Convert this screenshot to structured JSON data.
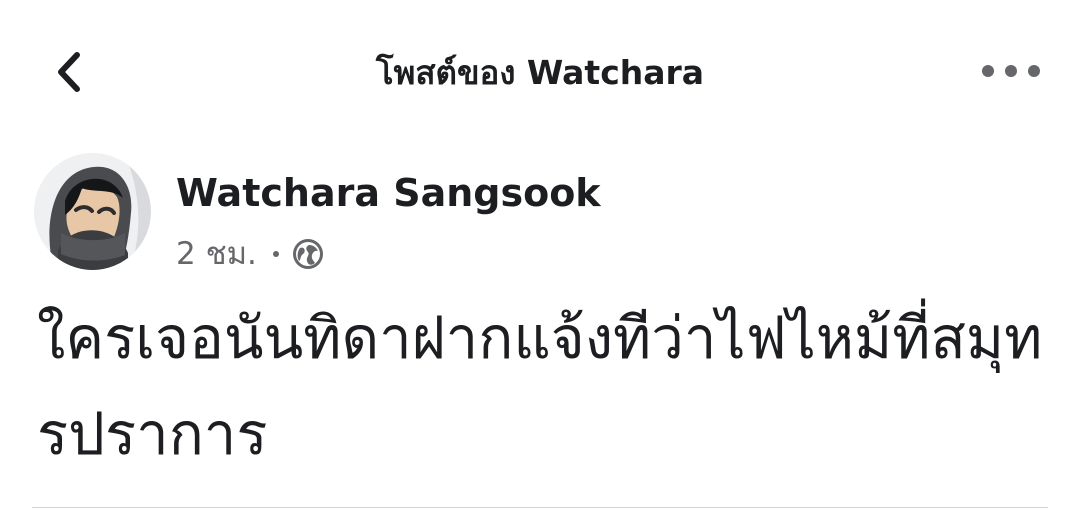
{
  "header": {
    "title": "โพสต์ของ Watchara",
    "back_icon": "chevron-left-icon",
    "more_icon": "more-horizontal-icon"
  },
  "post": {
    "author": "Watchara Sangsook",
    "time": "2 ชม.",
    "privacy_icon": "globe-icon",
    "text": "ใครเจอนันทิดาฝากแจ้งทีว่าไฟไหม้ที่สมุทรปราการ"
  },
  "colors": {
    "primary_text": "#1c1e21",
    "secondary_text": "#65676b",
    "divider": "#cfd2d6",
    "background": "#ffffff"
  }
}
